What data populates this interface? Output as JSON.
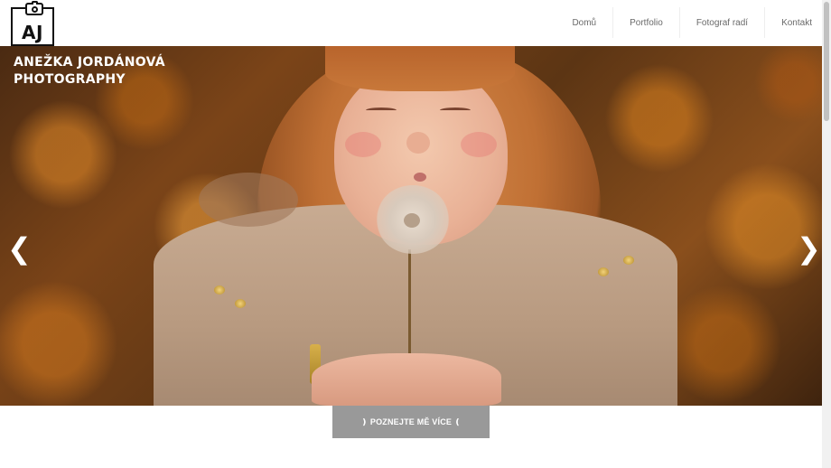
{
  "logo": {
    "text": "AJ",
    "icon": "camera-icon"
  },
  "nav": {
    "items": [
      {
        "label": "Domů"
      },
      {
        "label": "Portfolio"
      },
      {
        "label": "Fotograf radí"
      },
      {
        "label": "Kontakt"
      }
    ]
  },
  "hero": {
    "brand_line1": "ANEŽKA JORDÁNOVÁ",
    "brand_line2": "PHOTOGRAPHY",
    "prev_arrow": "❮",
    "next_arrow": "❯",
    "image_subject": "girl-blowing-dandelion-photo"
  },
  "cta": {
    "label": "❫ POZNEJTE MĚ VÍCE ❪"
  },
  "colors": {
    "cta_bg": "#999999",
    "accent_yellow": "#f2c230",
    "nav_text": "#6a6a6a"
  }
}
